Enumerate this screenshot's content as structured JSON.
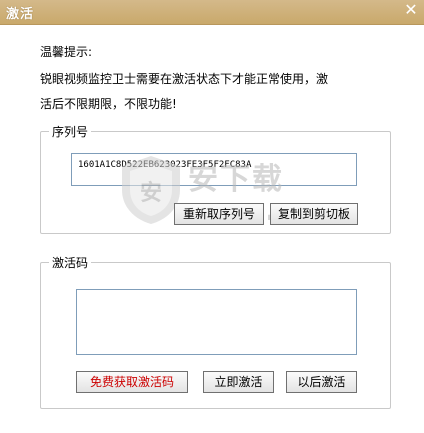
{
  "window": {
    "title": "激活",
    "close_glyph": "✕"
  },
  "hint": {
    "heading": "温馨提示:",
    "line1": "锐眼视频监控卫士需要在激活状态下才能正常使用，激",
    "line2": "活后不限期限，不限功能!"
  },
  "serial_group": {
    "label": "序列号",
    "value": "1601A1C8D522EB623023FE3F5F2FC83A",
    "refresh_button": "重新取序列号",
    "copy_button": "复制到剪切板"
  },
  "activation_group": {
    "label": "激活码",
    "code_value": "",
    "free_button": "免费获取激活码",
    "activate_button": "立即激活",
    "later_button": "以后激活"
  },
  "watermark": {
    "top_text": "安下载",
    "bottom_text": "anxz.com",
    "shield_glyph": "安"
  },
  "colors": {
    "titlebar": "#c9a96b",
    "red_button_text": "#cc0000"
  }
}
